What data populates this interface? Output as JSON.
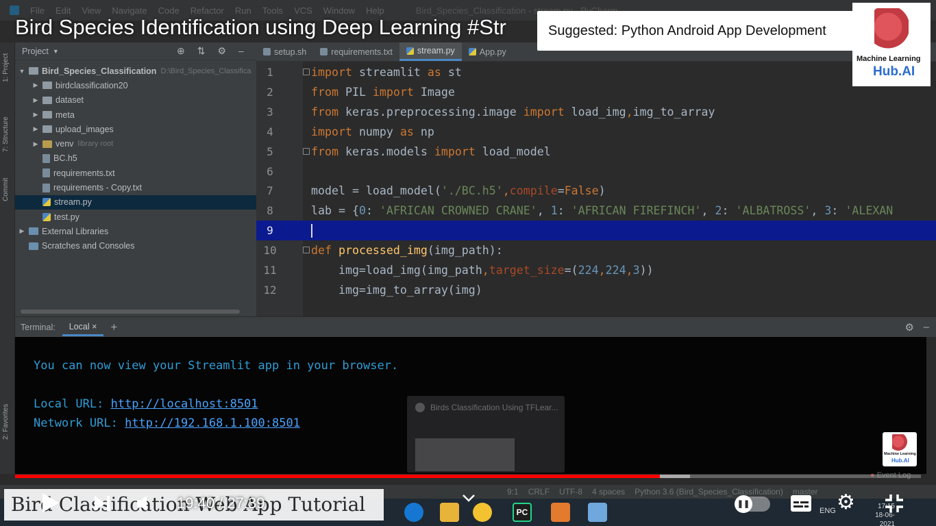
{
  "ide": {
    "menu": [
      "File",
      "Edit",
      "View",
      "Navigate",
      "Code",
      "Refactor",
      "Run",
      "Tools",
      "VCS",
      "Window",
      "Help"
    ],
    "window_title": "Bird_Species_Classification - stream.py - PyCharm",
    "side_tabs": [
      "1: Project",
      "7: Structure",
      "Commit",
      "2: Favorites"
    ]
  },
  "project": {
    "header": "Project",
    "tree": [
      {
        "label": "Bird_Species_Classification",
        "hint": "D:\\Bird_Species_Classifica",
        "kind": "folder",
        "expanded": true,
        "depth": 0
      },
      {
        "label": "birdclassification20",
        "hint": "",
        "kind": "folder",
        "expanded": false,
        "depth": 1
      },
      {
        "label": "dataset",
        "hint": "",
        "kind": "folder",
        "expanded": false,
        "depth": 1
      },
      {
        "label": "meta",
        "hint": "",
        "kind": "folder",
        "expanded": false,
        "depth": 1
      },
      {
        "label": "upload_images",
        "hint": "",
        "kind": "folder",
        "expanded": false,
        "depth": 1
      },
      {
        "label": "venv",
        "hint": "library root",
        "kind": "folder-o",
        "expanded": false,
        "depth": 1
      },
      {
        "label": "BC.h5",
        "hint": "",
        "kind": "file",
        "depth": 1
      },
      {
        "label": "requirements.txt",
        "hint": "",
        "kind": "file",
        "depth": 1
      },
      {
        "label": "requirements - Copy.txt",
        "hint": "",
        "kind": "file",
        "depth": 1
      },
      {
        "label": "stream.py",
        "hint": "",
        "kind": "py",
        "depth": 1,
        "selected": true
      },
      {
        "label": "test.py",
        "hint": "",
        "kind": "py",
        "depth": 1
      },
      {
        "label": "External Libraries",
        "hint": "",
        "kind": "lib",
        "expanded": false,
        "depth": 0
      },
      {
        "label": "Scratches and Consoles",
        "hint": "",
        "kind": "lib",
        "depth": 0
      }
    ]
  },
  "editor": {
    "tabs": [
      {
        "label": "setup.sh",
        "active": false,
        "py": false
      },
      {
        "label": "requirements.txt",
        "active": false,
        "py": false
      },
      {
        "label": "stream.py",
        "active": true,
        "py": true
      },
      {
        "label": "App.py",
        "active": false,
        "py": true
      }
    ],
    "current_line": 9,
    "lines": [
      {
        "n": "1",
        "tokens": [
          [
            "kw",
            "import"
          ],
          [
            "p",
            " streamlit "
          ],
          [
            "kw",
            "as"
          ],
          [
            "p",
            " st"
          ]
        ]
      },
      {
        "n": "2",
        "tokens": [
          [
            "kw",
            "from"
          ],
          [
            "p",
            " PIL "
          ],
          [
            "kw",
            "import"
          ],
          [
            "p",
            " Image"
          ]
        ]
      },
      {
        "n": "3",
        "tokens": [
          [
            "kw",
            "from"
          ],
          [
            "p",
            " keras.preprocessing.image "
          ],
          [
            "kw",
            "import"
          ],
          [
            "p",
            " load_img"
          ],
          [
            "kw",
            ","
          ],
          [
            "p",
            "img_to_array"
          ]
        ]
      },
      {
        "n": "4",
        "tokens": [
          [
            "kw",
            "import"
          ],
          [
            "p",
            " numpy "
          ],
          [
            "kw",
            "as"
          ],
          [
            "p",
            " np"
          ]
        ]
      },
      {
        "n": "5",
        "tokens": [
          [
            "kw",
            "from"
          ],
          [
            "p",
            " keras.models "
          ],
          [
            "kw",
            "import"
          ],
          [
            "p",
            " load_model"
          ]
        ]
      },
      {
        "n": "6",
        "tokens": []
      },
      {
        "n": "7",
        "tokens": [
          [
            "p",
            "model = load_model("
          ],
          [
            "str",
            "'./BC.h5'"
          ],
          [
            "kw",
            ","
          ],
          [
            "prm",
            "compile"
          ],
          [
            "p",
            "="
          ],
          [
            "kw",
            "False"
          ],
          [
            "p",
            ")"
          ]
        ]
      },
      {
        "n": "8",
        "tokens": [
          [
            "p",
            "lab = {"
          ],
          [
            "num",
            "0"
          ],
          [
            "p",
            ": "
          ],
          [
            "str",
            "'AFRICAN CROWNED CRANE'"
          ],
          [
            "p",
            ", "
          ],
          [
            "num",
            "1"
          ],
          [
            "p",
            ": "
          ],
          [
            "str",
            "'AFRICAN FIREFINCH'"
          ],
          [
            "p",
            ", "
          ],
          [
            "num",
            "2"
          ],
          [
            "p",
            ": "
          ],
          [
            "str",
            "'ALBATROSS'"
          ],
          [
            "p",
            ", "
          ],
          [
            "num",
            "3"
          ],
          [
            "p",
            ": "
          ],
          [
            "str",
            "'ALEXAN"
          ]
        ]
      },
      {
        "n": "9",
        "tokens": []
      },
      {
        "n": "10",
        "tokens": [
          [
            "kw",
            "def"
          ],
          [
            "p",
            " "
          ],
          [
            "fn",
            "processed_img"
          ],
          [
            "p",
            "(img_path):"
          ]
        ]
      },
      {
        "n": "11",
        "tokens": [
          [
            "p",
            "    img=load_img(img_path"
          ],
          [
            "kw",
            ","
          ],
          [
            "prm",
            "target_size"
          ],
          [
            "p",
            "=("
          ],
          [
            "num",
            "224"
          ],
          [
            "kw",
            ","
          ],
          [
            "num",
            "224"
          ],
          [
            "kw",
            ","
          ],
          [
            "num",
            "3"
          ],
          [
            "p",
            "))"
          ]
        ]
      },
      {
        "n": "12",
        "tokens": [
          [
            "p",
            "    img=img_to_array(img)"
          ]
        ]
      }
    ]
  },
  "terminal": {
    "label": "Terminal:",
    "tab": "Local",
    "line1": "You can now view your Streamlit app in your browser.",
    "local_label": "Local URL: ",
    "local_url": "http://localhost:8501",
    "network_label": "Network URL: ",
    "network_url": "http://192.168.1.100:8501",
    "ghost_window_title": "Birds Classification Using TFLear..."
  },
  "statusbar": {
    "items": [
      "Event Log",
      "9:1",
      "CRLF",
      "UTF-8",
      "4 spaces",
      "Python 3.6 (Bird_Species_Classification)",
      "master"
    ]
  },
  "video": {
    "title": "Bird Species Identification using Deep Learning #Str",
    "suggestion": "Suggested: Python Android App Development",
    "brand_line1": "Machine Learning",
    "brand_line2": "Hub.AI",
    "banner": "Bird Classification Web App Tutorial",
    "time": "19:40 / 27:39",
    "progress_fraction": 0.712,
    "buffered_fraction": 0.745,
    "lang": "ENG",
    "clock_time": "17:15",
    "clock_date": "18-06-2021",
    "accent_red": "#ff0000"
  }
}
